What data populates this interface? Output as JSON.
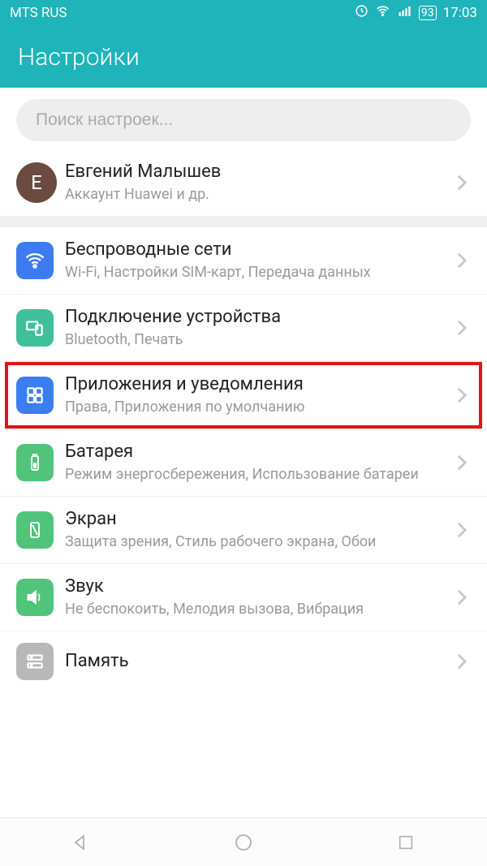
{
  "status": {
    "carrier": "MTS RUS",
    "battery_pct": "93",
    "time": "17:03"
  },
  "header": {
    "title": "Настройки"
  },
  "search": {
    "placeholder": "Поиск настроек..."
  },
  "account": {
    "initial": "Е",
    "name": "Евгений Малышев",
    "sub": "Аккаунт Huawei и др."
  },
  "items": {
    "wireless": {
      "title": "Беспроводные сети",
      "sub": "Wi-Fi, Настройки SIM-карт, Передача данных"
    },
    "device": {
      "title": "Подключение устройства",
      "sub": "Bluetooth, Печать"
    },
    "apps": {
      "title": "Приложения и уведомления",
      "sub": "Права, Приложения по умолчанию"
    },
    "battery": {
      "title": "Батарея",
      "sub": "Режим энергосбережения, Использование батареи"
    },
    "display": {
      "title": "Экран",
      "sub": "Защита зрения, Стиль рабочего экрана, Обои"
    },
    "sound": {
      "title": "Звук",
      "sub": "Не беспокоить, Мелодия вызова, Вибрация"
    },
    "storage": {
      "title": "Память",
      "sub": ""
    }
  }
}
